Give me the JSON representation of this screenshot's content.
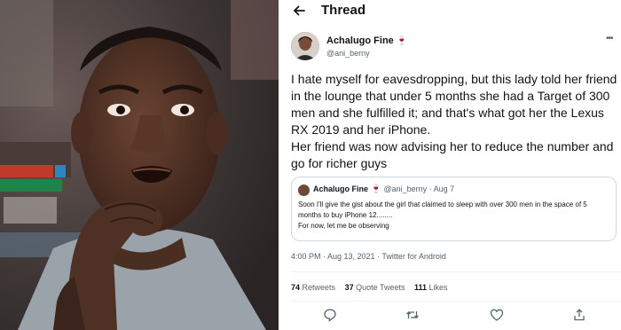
{
  "header": {
    "title": "Thread"
  },
  "tweet": {
    "author_name": "Achalugo Fine",
    "author_emoji": "🍷",
    "handle": "@ani_berny",
    "text": "I hate myself for eavesdropping, but this lady told her friend in the lounge that under 5 months she had a Target of 300 men and she fulfilled it; and that's what got her the Lexus RX 2019 and her iPhone.\nHer friend was now advising her to reduce the number and go for richer guys",
    "timestamp": "4:00 PM · Aug 13, 2021 · Twitter for Android",
    "stats": {
      "retweets_count": "74",
      "retweets_label": "Retweets",
      "quotes_count": "37",
      "quotes_label": "Quote Tweets",
      "likes_count": "111",
      "likes_label": "Likes"
    }
  },
  "quoted": {
    "author_name": "Achalugo Fine",
    "author_emoji": "🍷",
    "meta": "@ani_berny · Aug 7",
    "text": "Soon I'll give the gist about the girl that claimed to sleep with over 300 men in the space of 5 months to buy iPhone 12........\nFor now, let me be observing"
  },
  "actions": [
    "reply-icon",
    "retweet-icon",
    "like-icon",
    "share-icon"
  ],
  "colors": {
    "text": "#0f1419",
    "secondary": "#536471",
    "border": "#cfd9de",
    "emoji": "#c0233a"
  }
}
